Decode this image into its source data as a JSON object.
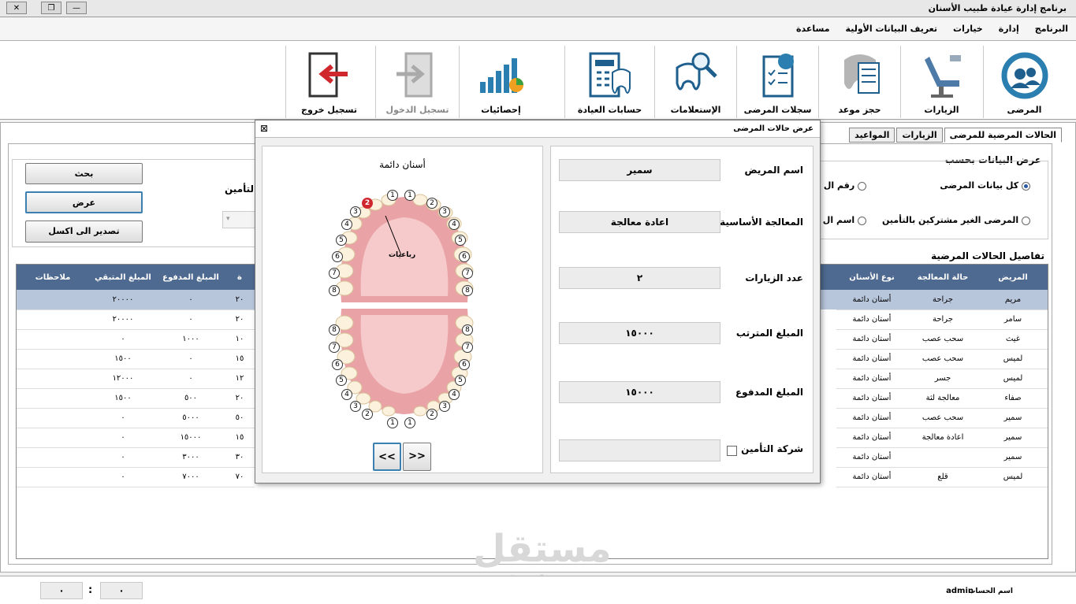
{
  "window": {
    "title": "برنامج إدارة عيادة طبيب الأسنان",
    "close": "✕",
    "restore": "❐",
    "minimize": "—"
  },
  "menu": [
    "البرنامج",
    "إدارة",
    "خيارات",
    "تعريف البيانات الأولية",
    "مساعدة"
  ],
  "toolbar": [
    {
      "label": "المرضى",
      "icon": "patients-icon"
    },
    {
      "label": "الزيارات",
      "icon": "dental-chair-icon"
    },
    {
      "label": "حجز موعد",
      "icon": "appointment-icon"
    },
    {
      "label": "سجلات المرضى",
      "icon": "records-icon"
    },
    {
      "label": "الإستعلامات",
      "icon": "search-tooth-icon"
    },
    {
      "label": "حسابات العيادة",
      "icon": "accounts-icon"
    },
    {
      "label": "إحصائيات",
      "icon": "statistics-icon"
    },
    {
      "label": "تسجيل الدخول",
      "icon": "login-icon"
    },
    {
      "label": "تسجيل خروج",
      "icon": "logout-icon"
    }
  ],
  "tabs": [
    "الحالات المرضية للمرضى",
    "الزيارات",
    "المواعيد"
  ],
  "filter": {
    "legend": "عرض البيانات بحسب",
    "opt_all": "كل بيانات المرضى",
    "opt_noins": "المرضى الغير مشتركين بالتأمين",
    "opt_num": "رقم ال",
    "opt_name": "اسم ال",
    "ins_label": "التأمين"
  },
  "buttons": {
    "search": "بحث",
    "show": "عرض",
    "export": "تصدير الى اكسل"
  },
  "details_legend": "تفاصيل الحالات المرضية",
  "grid": {
    "right_headers": [
      "المريض",
      "حالة المعالجة",
      "نوع الأسنان"
    ],
    "left_headers": [
      "ملاحظات",
      "المبلغ المتبقي",
      "المبلغ المدفوع",
      "ة"
    ],
    "rows": [
      [
        "مريم",
        "جراحة",
        "أستان دائمة",
        "٢٠٠٠٠",
        "٠",
        "٢٠"
      ],
      [
        "سامر",
        "جراحة",
        "أستان دائمة",
        "٢٠٠٠٠",
        "٠",
        "٢٠"
      ],
      [
        "غيث",
        "سحب عصب",
        "أستان دائمة",
        "٠",
        "١٠٠٠",
        "١٠"
      ],
      [
        "لميس",
        "سحب عصب",
        "أستان دائمة",
        "١٥٠٠",
        "٠",
        "١٥"
      ],
      [
        "لميس",
        "جسر",
        "أستان دائمة",
        "١٢٠٠٠",
        "٠",
        "١٢"
      ],
      [
        "صفاء",
        "معالجة لثة",
        "أستان دائمة",
        "١٥٠٠",
        "٥٠٠",
        "٢٠"
      ],
      [
        "سمير",
        "سحب عصب",
        "أستان دائمة",
        "٠",
        "٥٠٠٠",
        "٥٠"
      ],
      [
        "سمير",
        "اعادة معالجة",
        "أستان دائمة",
        "٠",
        "١٥٠٠٠",
        "١٥"
      ],
      [
        "سمير",
        "",
        "أستان دائمة",
        "٠",
        "٣٠٠٠",
        "٣٠"
      ],
      [
        "لميس",
        "قلع",
        "أستان دائمة",
        "٠",
        "٧٠٠٠",
        "٧٠"
      ]
    ]
  },
  "dialog": {
    "title": "عرض حالات المرضى",
    "close": "⊠",
    "chart_title": "أسنان دائمة",
    "quad_label": "رباعيات",
    "prev": "<<",
    "next": ">>",
    "fields": [
      {
        "label": "اسم المريض",
        "value": "سمير"
      },
      {
        "label": "المعالجة الأساسية",
        "value": "اعادة معالجة"
      },
      {
        "label": "عدد الزيارات",
        "value": "٢"
      },
      {
        "label": "المبلغ المترتب",
        "value": "١٥٠٠٠"
      },
      {
        "label": "المبلغ المدفوع",
        "value": "١٥٠٠٠"
      },
      {
        "label": "شركة التأمين",
        "value": ""
      }
    ],
    "upper_teeth": [
      "8",
      "7",
      "6",
      "5",
      "4",
      "3",
      "2",
      "1",
      "1",
      "2",
      "3",
      "4",
      "5",
      "6",
      "7",
      "8"
    ],
    "lower_teeth": [
      "8",
      "7",
      "6",
      "5",
      "4",
      "3",
      "2",
      "1",
      "1",
      "2",
      "3",
      "4",
      "5",
      "6",
      "7",
      "8"
    ]
  },
  "status": {
    "user_label": "اسم الحساب",
    "user": "admin",
    "t1": "٠",
    "sep": ":",
    "t2": "٠"
  },
  "watermark": {
    "arabic": "مستقل",
    "latin": "mostaql.com"
  },
  "colors": {
    "header": "#4f6a90",
    "selected_row": "#b8c6dc",
    "selected_tooth": "#d0262e"
  }
}
